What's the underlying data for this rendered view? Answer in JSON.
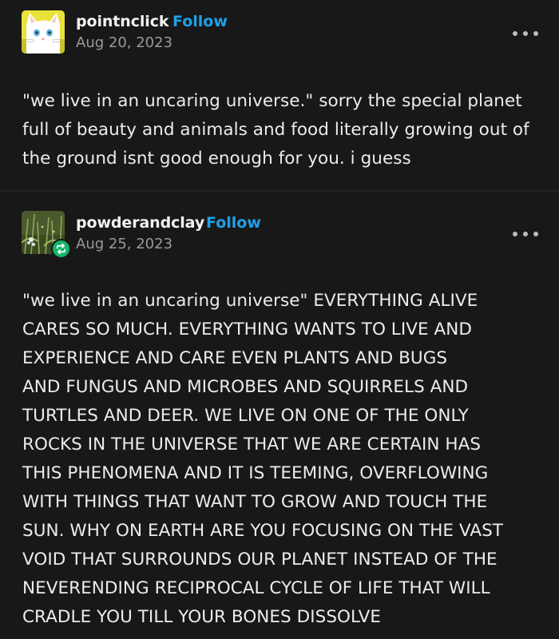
{
  "posts": [
    {
      "username": "pointnclick",
      "follow_label": "Follow",
      "date": "Aug 20, 2023",
      "avatar_icon": "white-cat-avatar",
      "lines": [
        "\"we live in an uncaring universe.\" sorry the special planet",
        "full of beauty and animals and food literally growing out of",
        "the ground isnt good enough for you. i guess"
      ]
    },
    {
      "username": "powderandclay",
      "follow_label": "Follow",
      "date": "Aug 25, 2023",
      "avatar_icon": "plant-photo-avatar",
      "badge_icon": "reblog-icon",
      "lines": [
        "\"we live in an uncaring universe\" EVERYTHING ALIVE",
        "CARES SO MUCH. EVERYTHING WANTS TO LIVE AND",
        "EXPERIENCE AND CARE EVEN PLANTS AND BUGS",
        "AND FUNGUS AND MICROBES AND SQUIRRELS AND",
        "TURTLES AND DEER. WE LIVE ON ONE OF THE ONLY",
        "ROCKS IN THE UNIVERSE THAT WE ARE CERTAIN HAS",
        "THIS PHENOMENA AND IT IS TEEMING, OVERFLOWING",
        "WITH THINGS THAT WANT TO GROW AND TOUCH THE",
        "SUN. WHY ON EARTH ARE YOU FOCUSING ON THE VAST",
        "VOID THAT SURROUNDS OUR PLANET INSTEAD OF THE",
        "NEVERENDING RECIPROCAL CYCLE OF LIFE THAT WILL",
        "CRADLE YOU TILL YOUR BONES DISSOLVE"
      ]
    }
  ],
  "colors": {
    "background": "#181818",
    "text": "#ececec",
    "follow": "#20a0e8",
    "date": "#9a9a9a",
    "reblog_badge": "#14b66a"
  }
}
